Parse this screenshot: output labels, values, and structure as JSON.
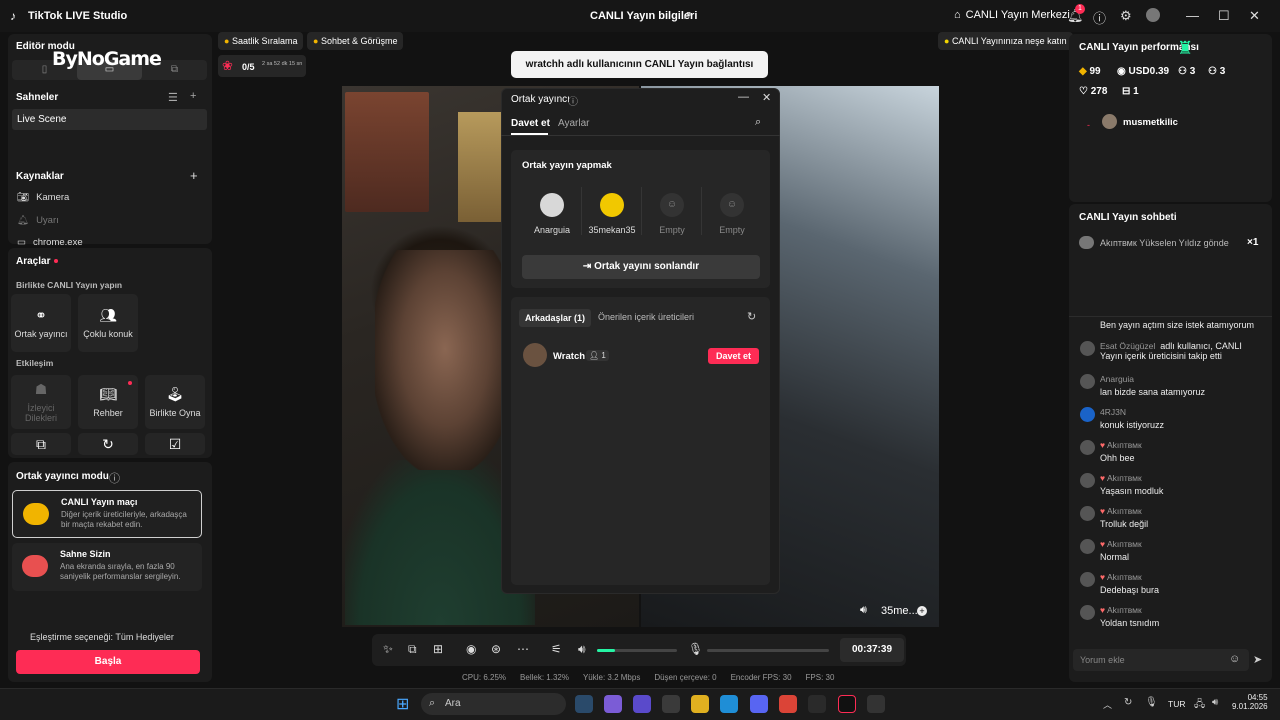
{
  "titlebar": {
    "app_title": "TikTok LIVE Studio",
    "live_info": "CANLI Yayın bilgileri",
    "center_button": "CANLI Yayın Merkezi",
    "notif_count": "1"
  },
  "watermark": "ByNoGame",
  "left": {
    "editor_mode": "Editör modu",
    "scenes_title": "Sahneler",
    "scene": "Live Scene",
    "sources_title": "Kaynaklar",
    "sources": [
      "Kamera",
      "Uyarı",
      "chrome.exe"
    ],
    "tools_title": "Araçlar",
    "together_title": "Birlikte CANLI Yayın yapın",
    "cohost": "Ortak yayıncı",
    "multi_guest": "Çoklu konuk",
    "interaction_title": "Etkileşim",
    "viewer_requests": "İzleyici Dilekleri",
    "guide": "Rehber",
    "play_together": "Birlikte Oyna",
    "cohost_mode_title": "Ortak yayıncı modu",
    "mode1_title": "CANLI Yayın maçı",
    "mode1_desc": "Diğer içerik üreticileriyle, arkadaşça bir maçta rekabet edin.",
    "mode2_title": "Sahne Sizin",
    "mode2_desc": "Ana ekranda sırayla, en fazla 90 saniyelik performanslar sergileyin.",
    "match_option": "Eşleştirme seçeneği: Tüm Hediyeler",
    "start_button": "Başla"
  },
  "top_strip": {
    "chip_ranking": "Saatlik Sıralama",
    "chip_chat": "Sohbet & Görüşme",
    "chip_joy": "CANLI Yayınınıza neşe katın",
    "goal_count": "0/5",
    "goal_timer": "2 sa 52 dk 15 sn"
  },
  "toast": "wratchh adlı kullanıcının CANLI Yayın bağlantısı kesildi",
  "video": {
    "right_name": "35me..."
  },
  "dialog": {
    "title": "Ortak yayıncı",
    "tab_invite": "Davet et",
    "tab_settings": "Ayarlar",
    "section_title": "Ortak yayın yapmak",
    "slots": [
      "Anarguia",
      "35mekan35",
      "Empty",
      "Empty"
    ],
    "end_button": "Ortak yayını sonlandır",
    "friends_tab": "Arkadaşlar (1)",
    "suggested_tab": "Önerilen içerik üreticileri",
    "friend_name": "Wratch",
    "friend_count": "1",
    "invite_button": "Davet et"
  },
  "controls": {
    "timer": "00:37:39",
    "volume_level": 0.22,
    "stats": [
      "CPU: 6.25%",
      "Bellek: 1.32%",
      "Yükle: 3.2 Mbps",
      "Düşen çerçeve: 0",
      "Encoder FPS: 30",
      "FPS: 30"
    ]
  },
  "right": {
    "perf_title": "CANLI Yayın performansı",
    "coins": "99",
    "usd": "USD0.39",
    "viewers": "3",
    "followers": "3",
    "likes": "278",
    "gifts": "1",
    "top_viewer": "musmetkilic",
    "chat_title": "CANLI Yayın sohbeti",
    "pinned": "Akıптвмк Yükselen Yıldız gönde",
    "pinned_count": "×1",
    "messages": [
      {
        "user": "",
        "text": "Ben yayın açtım size istek atamıyorum"
      },
      {
        "user": "Esat Özügüzel",
        "text": "adlı kullanıcı, CANLI Yayın içerik üreticisini takip etti"
      },
      {
        "user": "Anarguia",
        "text": "lan bizde sana atamıyoruz"
      },
      {
        "user": "4RJ3N",
        "text": "konuk istiyoruzz"
      },
      {
        "user": "Akıптвмк",
        "text": "Ohh bee"
      },
      {
        "user": "Akıптвмк",
        "text": "Yaşasın modluk"
      },
      {
        "user": "Akıптвмк",
        "text": "Trolluk değil"
      },
      {
        "user": "Akıптвмк",
        "text": "Normal"
      },
      {
        "user": "Akıптвмк",
        "text": "Dedebaşı bura"
      },
      {
        "user": "Akıптвмк",
        "text": "Yoldan tsnıdım"
      }
    ],
    "comment_placeholder": "Yorum ekle"
  },
  "taskbar": {
    "search": "Ara",
    "lang": "TUR",
    "time": "04:55",
    "date": "9.01.2026"
  },
  "colors": {
    "accent": "#fe2c55",
    "teal": "#25f4a4"
  }
}
